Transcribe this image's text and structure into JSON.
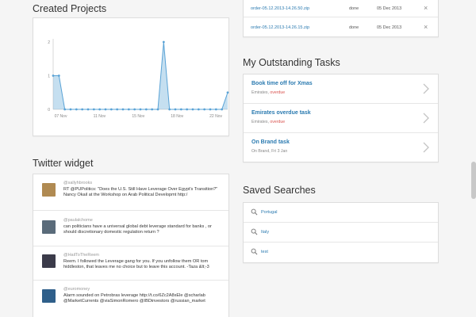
{
  "created_projects": {
    "title": "Created Projects",
    "chart_data": {
      "type": "area",
      "x_tick_labels": [
        "07 Nov",
        "11 Nov",
        "15 Nov",
        "18 Nov",
        "22 Nov"
      ],
      "y_tick_labels": [
        "2",
        "1",
        "0"
      ],
      "ylim": [
        0,
        2
      ],
      "series": [
        {
          "values": [
            1,
            1,
            0,
            0,
            0,
            0,
            0,
            0,
            0,
            0,
            0,
            0,
            0,
            0,
            0,
            0,
            0,
            0,
            0,
            2,
            0,
            0,
            0,
            0,
            0,
            0,
            0,
            0,
            0,
            0,
            0.5
          ]
        }
      ],
      "grid": false,
      "color": "#7fb7dd"
    }
  },
  "twitter": {
    "title": "Twitter widget",
    "tweets": [
      {
        "handle": "@sallyhbrooks",
        "text": "RT @PUPolitics: \"Does the U.S. Still Have Leverage Over Egypt's Transition?\" Nancy Okail at the Workshop on Arab Political Developmt http:/",
        "avatar_color": "#b08a52"
      },
      {
        "handle": "@paulalchome",
        "text": "can politicians have a universal global debt leverage standard for banks , or should discretionary domestic regulation return ?",
        "avatar_color": "#5a6b7a"
      },
      {
        "handle": "@HailToTheReem",
        "text": "Reem. I followed the Leverage gang for you. If you unfollow them OR tom hiddleston, that leaves me no choice but to leave this account. -Taza &lt;-3",
        "avatar_color": "#3b3b4a"
      },
      {
        "handle": "@euromoney",
        "text": "Alarm sounded on Petrobras leverage http://t.co/6Zc2A8xEle @scharlab @MarketCurrents @viaSimonRomero @IBDinvestors @russian_market",
        "avatar_color": "#2f5f8a"
      }
    ]
  },
  "downloads": [
    {
      "name": "order-05.12.2013-14.26.50.zip",
      "status": "done",
      "date": "05 Dec 2013"
    },
    {
      "name": "order-05.12.2013-14.26.15.zip",
      "status": "done",
      "date": "05 Dec 2013"
    }
  ],
  "tasks": {
    "title": "My Outstanding Tasks",
    "items": [
      {
        "title": "Book time off for Xmas",
        "sub": "Emirates, ",
        "flag": "overdue"
      },
      {
        "title": "Emirates overdue task",
        "sub": "Emirates, ",
        "flag": "overdue"
      },
      {
        "title": "On Brand task",
        "sub": "On Brand, Fri 3 Jan",
        "flag": ""
      }
    ]
  },
  "saved_searches": {
    "title": "Saved Searches",
    "items": [
      "Portugal",
      "Italy",
      "test"
    ]
  },
  "colors": {
    "link": "#2a7ab0",
    "overdue": "#d9534f",
    "chart": "#7fb7dd"
  },
  "icons": {
    "remove": "×",
    "chevron": "chevron-right-icon",
    "search": "search-icon"
  }
}
